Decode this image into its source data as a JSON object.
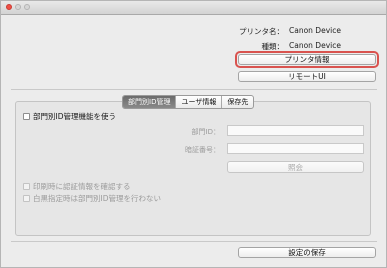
{
  "printer_info": {
    "name_label": "プリンタ名：",
    "name_value": "Canon Device",
    "type_label": "種類：",
    "type_value": "Canon Device"
  },
  "buttons": {
    "printer_info": "プリンタ情報",
    "remote_ui": "リモートUI",
    "verify": "照会",
    "save_settings": "設定の保存"
  },
  "tabs": [
    {
      "label": "部門別ID管理",
      "active": true
    },
    {
      "label": "ユーザ情報",
      "active": false
    },
    {
      "label": "保存先",
      "active": false
    }
  ],
  "dept_id": {
    "enable_label": "部門別ID管理機能を使う",
    "enable_checked": false,
    "id_label": "部門ID：",
    "id_value": "",
    "pin_label": "暗証番号：",
    "pin_value": ""
  },
  "options": {
    "confirm_on_print": "印刷時に認証情報を確認する",
    "bw_no_id": "白黒指定時は部門別ID管理を行わない"
  }
}
